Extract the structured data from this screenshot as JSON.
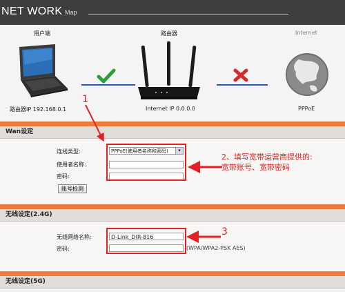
{
  "header": {
    "title": "NET WORK",
    "subtitle": "Map"
  },
  "map": {
    "pc_label": "用户端",
    "router_label": "路由器",
    "internet_label": "Internet",
    "router_ip": "路由器IP 192.168.0.1",
    "internet_ip": "Internet IP 0.0.0.0",
    "conn_type": "PPPoE",
    "link_ok_color": "#2e9e3a",
    "link_fail_color": "#d62b2b"
  },
  "wan": {
    "title": "Wan设定",
    "conn_type_label": "连线类型:",
    "conn_type_value": "PPPoE(使用者名称和密码)",
    "username_label": "使用者名称:",
    "username_value": "",
    "password_label": "密码:",
    "password_value": "",
    "check_button": "账号检测"
  },
  "wireless24": {
    "title": "无线设定(2.4G)",
    "ssid_label": "无线网络名称:",
    "ssid_value": "D-Link_DIR-816",
    "password_label": "密码:",
    "password_value": "",
    "security_note": "(WPA/WPA2-PSK AES)"
  },
  "wireless5": {
    "title": "无线设定(5G)"
  },
  "annotations": {
    "step1": "1",
    "step2_line1": "2、填写宽带运营商提供的:",
    "step2_line2": "宽带账号、宽带密码",
    "step3": "3"
  },
  "colors": {
    "accent_orange": "#ee7b3a",
    "annotation_red": "#e22222",
    "header_bg": "#3e3e3e"
  }
}
